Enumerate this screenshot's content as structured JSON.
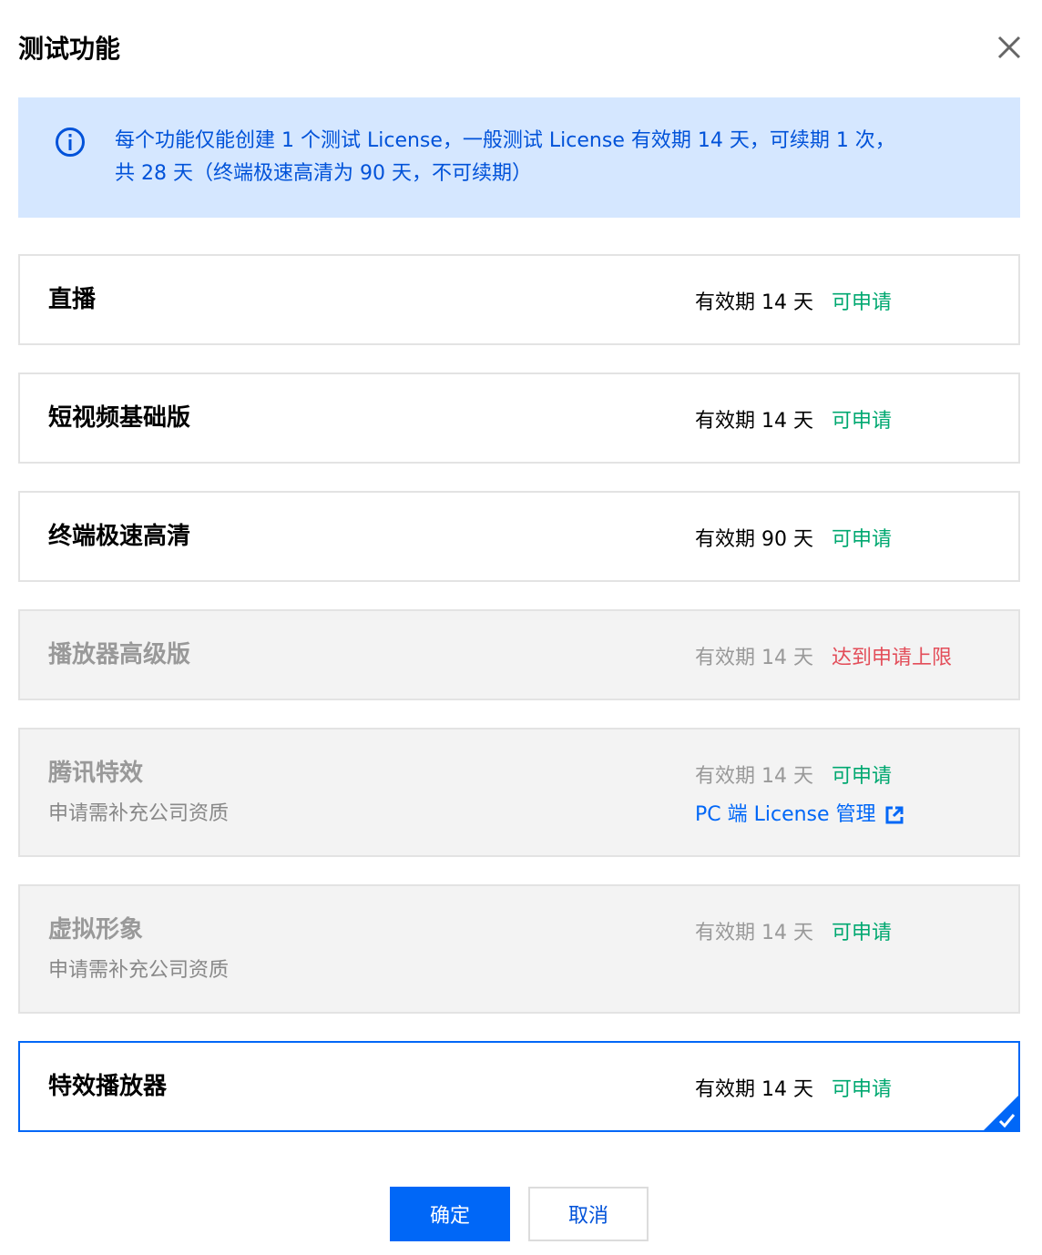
{
  "dialog": {
    "title": "测试功能"
  },
  "notice": {
    "line1": "每个功能仅能创建 1 个测试 License，一般测试 License 有效期 14 天，可续期 1 次，",
    "line2": "共 28 天（终端极速高清为 90 天，不可续期）"
  },
  "cards": [
    {
      "name": "直播",
      "validity": "有效期 14 天",
      "status": "可申请"
    },
    {
      "name": "短视频基础版",
      "validity": "有效期 14 天",
      "status": "可申请"
    },
    {
      "name": "终端极速高清",
      "validity": "有效期 90 天",
      "status": "可申请"
    },
    {
      "name": "播放器高级版",
      "validity": "有效期 14 天",
      "status": "达到申请上限"
    },
    {
      "name": "腾讯特效",
      "subtitle": "申请需补充公司资质",
      "validity": "有效期 14 天",
      "status": "可申请",
      "link": "PC 端 License 管理"
    },
    {
      "name": "虚拟形象",
      "subtitle": "申请需补充公司资质",
      "validity": "有效期 14 天",
      "status": "可申请"
    },
    {
      "name": "特效播放器",
      "validity": "有效期 14 天",
      "status": "可申请"
    }
  ],
  "buttons": {
    "confirm": "确定",
    "cancel": "取消"
  },
  "colors": {
    "primary": "#0067f7",
    "success": "#00a870",
    "error": "#e34d59",
    "notice_bg": "#d5e7ff"
  }
}
